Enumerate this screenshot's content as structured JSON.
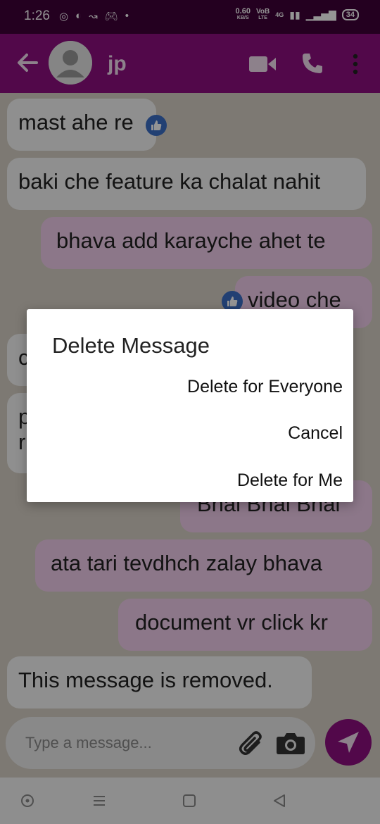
{
  "status_bar": {
    "time": "1:26",
    "speed": "0.60",
    "speed_unit": "KB/S",
    "volte_top": "VoB",
    "volte_bottom": "LTE",
    "network": "4G",
    "battery": "34"
  },
  "header": {
    "contact_name": "jp"
  },
  "messages": [
    {
      "text": "mast ahe re",
      "direction": "incoming",
      "liked": true
    },
    {
      "text": "baki che feature ka chalat nahit",
      "direction": "incoming"
    },
    {
      "text": "bhava add karayche ahet te",
      "direction": "outgoing"
    },
    {
      "text": "video che",
      "direction": "outgoing",
      "liked": true
    },
    {
      "text": "c",
      "direction": "incoming"
    },
    {
      "text": "p",
      "direction": "incoming"
    },
    {
      "text": "r",
      "direction": "incoming"
    },
    {
      "text": "Bhai Bhai Bhai",
      "direction": "outgoing"
    },
    {
      "text": "ata tari tevdhch zalay bhava",
      "direction": "outgoing"
    },
    {
      "text": "document vr click kr",
      "direction": "outgoing"
    },
    {
      "text": "This message is removed.",
      "direction": "incoming"
    }
  ],
  "composer": {
    "placeholder": "Type a message..."
  },
  "dialog": {
    "title": "Delete Message",
    "options": [
      "Delete for Everyone",
      "Cancel",
      "Delete for Me"
    ]
  },
  "colors": {
    "status_bar": "#3f0038",
    "app_bar": "#8e0f80",
    "outgoing_bubble": "#f2cdec",
    "incoming_bubble": "#f7f7f7",
    "like": "#3b6fc6"
  }
}
